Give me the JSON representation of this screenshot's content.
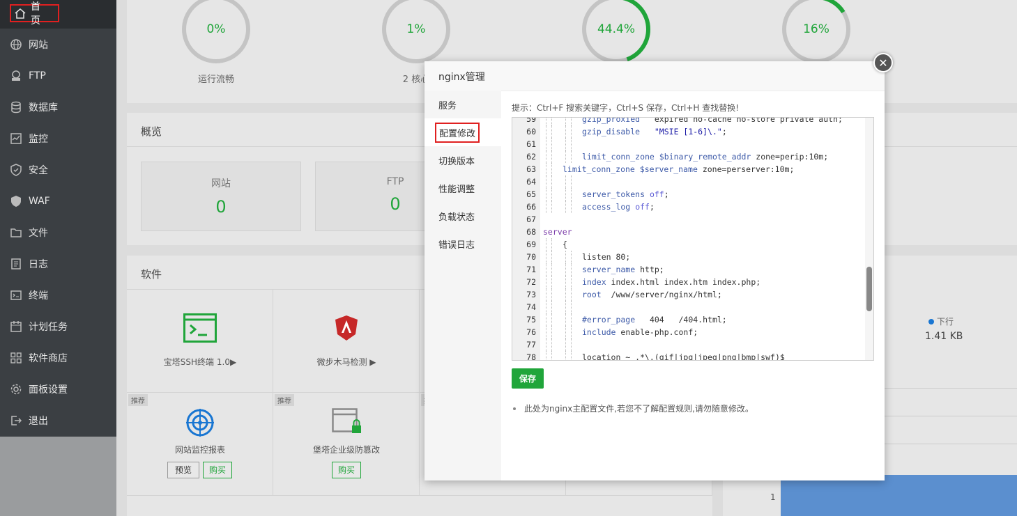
{
  "sidebar": {
    "items": [
      {
        "label": "首页",
        "icon": "home-icon"
      },
      {
        "label": "网站",
        "icon": "globe-icon"
      },
      {
        "label": "FTP",
        "icon": "ftp-icon"
      },
      {
        "label": "数据库",
        "icon": "database-icon"
      },
      {
        "label": "监控",
        "icon": "monitor-icon"
      },
      {
        "label": "安全",
        "icon": "shield-icon"
      },
      {
        "label": "WAF",
        "icon": "waf-icon"
      },
      {
        "label": "文件",
        "icon": "folder-icon"
      },
      {
        "label": "日志",
        "icon": "log-icon"
      },
      {
        "label": "终端",
        "icon": "terminal-icon"
      },
      {
        "label": "计划任务",
        "icon": "calendar-icon"
      },
      {
        "label": "软件商店",
        "icon": "grid-icon"
      },
      {
        "label": "面板设置",
        "icon": "gear-icon"
      },
      {
        "label": "退出",
        "icon": "logout-icon"
      }
    ]
  },
  "status": {
    "rings": [
      {
        "value": "0%",
        "label": "运行流畅",
        "fill": 0
      },
      {
        "value": "1%",
        "label": "2 核心",
        "fill": 0.01
      },
      {
        "value": "44.4%",
        "label": "",
        "fill": 0.444
      },
      {
        "value": "16%",
        "label": "",
        "fill": 0.16
      }
    ]
  },
  "overview": {
    "title": "概览",
    "stats": [
      {
        "title": "网站",
        "value": "0"
      },
      {
        "title": "FTP",
        "value": "0"
      }
    ]
  },
  "software": {
    "title": "软件",
    "items": [
      {
        "name": "宝塔SSH终端 1.0▶"
      },
      {
        "name": "微步木马检测 ▶"
      }
    ],
    "recommended": [
      {
        "tag": "推荐",
        "name": "网站监控报表",
        "preview": "预览",
        "buy": "购买"
      },
      {
        "tag": "推荐",
        "name": "堡塔企业级防篡改",
        "buy": "购买"
      },
      {
        "tag": "推荐"
      }
    ]
  },
  "traffic": {
    "down_label": "下行",
    "down_value": "1.41 KB",
    "axis_label": "1"
  },
  "modal": {
    "title": "nginx管理",
    "tabs": [
      "服务",
      "配置修改",
      "切换版本",
      "性能调整",
      "负载状态",
      "错误日志"
    ],
    "hint": "提示：Ctrl+F 搜索关键字，Ctrl+S 保存，Ctrl+H 查找替换!",
    "save_label": "保存",
    "note": "此处为nginx主配置文件,若您不了解配置规则,请勿随意修改。",
    "lines": [
      {
        "n": "59",
        "indent": 2,
        "parts": [
          [
            "dir",
            "gzip_proxied"
          ],
          [
            "kw",
            "   expired no-cache no-store private auth;"
          ]
        ]
      },
      {
        "n": "60",
        "indent": 2,
        "parts": [
          [
            "dir",
            "gzip_disable"
          ],
          [
            "kw",
            "   "
          ],
          [
            "str",
            "\"MSIE [1-6]\\.\""
          ],
          [
            "kw",
            ";"
          ]
        ]
      },
      {
        "n": "61",
        "indent": 2,
        "parts": []
      },
      {
        "n": "62",
        "indent": 2,
        "parts": [
          [
            "dir",
            "limit_conn_zone"
          ],
          [
            "kw",
            " "
          ],
          [
            "var",
            "$binary_remote_addr"
          ],
          [
            "kw",
            " zone=perip:10m;"
          ]
        ]
      },
      {
        "n": "63",
        "indent": 1,
        "parts": [
          [
            "dir",
            "limit_conn_zone"
          ],
          [
            "kw",
            " "
          ],
          [
            "var",
            "$server_name"
          ],
          [
            "kw",
            " zone=perserver:10m;"
          ]
        ]
      },
      {
        "n": "64",
        "indent": 2,
        "parts": []
      },
      {
        "n": "65",
        "indent": 2,
        "parts": [
          [
            "dir",
            "server_tokens"
          ],
          [
            "kw",
            " "
          ],
          [
            "val",
            "off"
          ],
          [
            "kw",
            ";"
          ]
        ]
      },
      {
        "n": "66",
        "indent": 2,
        "parts": [
          [
            "dir",
            "access_log"
          ],
          [
            "kw",
            " "
          ],
          [
            "val",
            "off"
          ],
          [
            "kw",
            ";"
          ]
        ]
      },
      {
        "n": "67",
        "indent": 0,
        "parts": []
      },
      {
        "n": "68",
        "indent": 0,
        "parts": [
          [
            "srv",
            "server"
          ]
        ]
      },
      {
        "n": "69",
        "indent": 1,
        "parts": [
          [
            "kw",
            "{"
          ]
        ]
      },
      {
        "n": "70",
        "indent": 2,
        "parts": [
          [
            "kw",
            "listen 80;"
          ]
        ]
      },
      {
        "n": "71",
        "indent": 2,
        "parts": [
          [
            "dir",
            "server_name"
          ],
          [
            "kw",
            " http;"
          ]
        ]
      },
      {
        "n": "72",
        "indent": 2,
        "parts": [
          [
            "dir",
            "index"
          ],
          [
            "kw",
            " index.html index.htm index.php;"
          ]
        ]
      },
      {
        "n": "73",
        "indent": 2,
        "parts": [
          [
            "dir",
            "root"
          ],
          [
            "kw",
            "  /www/server/nginx/html;"
          ]
        ]
      },
      {
        "n": "74",
        "indent": 2,
        "parts": []
      },
      {
        "n": "75",
        "indent": 2,
        "parts": [
          [
            "cm",
            "#error_page"
          ],
          [
            "kw",
            "   404   /404.html;"
          ]
        ]
      },
      {
        "n": "76",
        "indent": 2,
        "parts": [
          [
            "dir",
            "include"
          ],
          [
            "kw",
            " enable-php.conf;"
          ]
        ]
      },
      {
        "n": "77",
        "indent": 2,
        "parts": []
      },
      {
        "n": "78",
        "indent": 2,
        "parts": [
          [
            "kw",
            "location ~ .*\\.(gif|jpg|jpeg|png|bmp|swf)$"
          ]
        ]
      }
    ]
  }
}
